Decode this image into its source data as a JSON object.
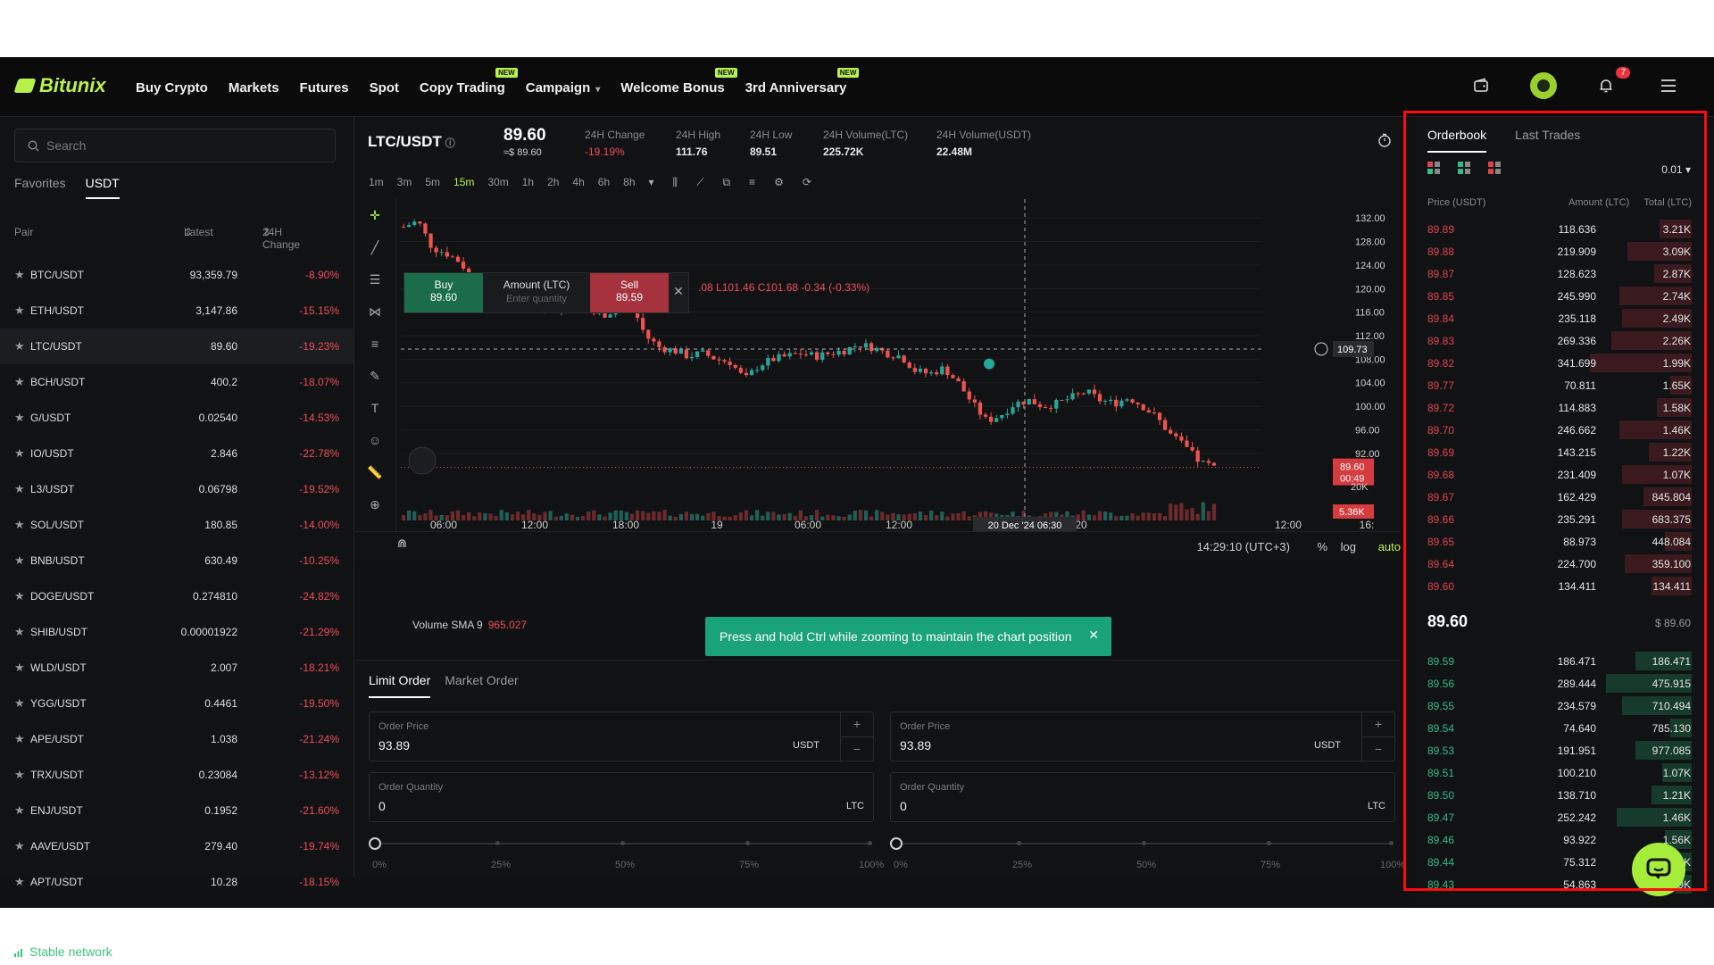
{
  "nav": {
    "brand": "Bitunix",
    "items": [
      {
        "label": "Buy Crypto",
        "new": ""
      },
      {
        "label": "Markets",
        "new": ""
      },
      {
        "label": "Futures",
        "new": ""
      },
      {
        "label": "Spot",
        "new": ""
      },
      {
        "label": "Copy Trading",
        "new": "NEW"
      },
      {
        "label": "Campaign",
        "new": "",
        "caret": "▾"
      },
      {
        "label": "Welcome Bonus",
        "new": "NEW"
      },
      {
        "label": "3rd Anniversary",
        "new": "NEW"
      }
    ],
    "notif_count": "7"
  },
  "left": {
    "search_placeholder": "Search",
    "tabs": [
      "Favorites",
      "USDT"
    ],
    "head": {
      "pair": "Pair",
      "latest": "Latest",
      "change": "24H Change"
    },
    "pairs": [
      {
        "pair": "BTC/USDT",
        "latest": "93,359.79",
        "change": "-8.90%"
      },
      {
        "pair": "ETH/USDT",
        "latest": "3,147.86",
        "change": "-15.15%"
      },
      {
        "pair": "LTC/USDT",
        "latest": "89.60",
        "change": "-19.23%"
      },
      {
        "pair": "BCH/USDT",
        "latest": "400.2",
        "change": "-18.07%"
      },
      {
        "pair": "G/USDT",
        "latest": "0.02540",
        "change": "-14.53%"
      },
      {
        "pair": "IO/USDT",
        "latest": "2.846",
        "change": "-22.78%"
      },
      {
        "pair": "L3/USDT",
        "latest": "0.06798",
        "change": "-19.52%"
      },
      {
        "pair": "SOL/USDT",
        "latest": "180.85",
        "change": "-14.00%"
      },
      {
        "pair": "BNB/USDT",
        "latest": "630.49",
        "change": "-10.25%"
      },
      {
        "pair": "DOGE/USDT",
        "latest": "0.274810",
        "change": "-24.82%"
      },
      {
        "pair": "SHIB/USDT",
        "latest": "0.00001922",
        "change": "-21.29%"
      },
      {
        "pair": "WLD/USDT",
        "latest": "2.007",
        "change": "-18.21%"
      },
      {
        "pair": "YGG/USDT",
        "latest": "0.4461",
        "change": "-19.50%"
      },
      {
        "pair": "APE/USDT",
        "latest": "1.038",
        "change": "-21.24%"
      },
      {
        "pair": "TRX/USDT",
        "latest": "0.23084",
        "change": "-13.12%"
      },
      {
        "pair": "ENJ/USDT",
        "latest": "0.1952",
        "change": "-21.60%"
      },
      {
        "pair": "AAVE/USDT",
        "latest": "279.40",
        "change": "-19.74%"
      },
      {
        "pair": "APT/USDT",
        "latest": "10.28",
        "change": "-18.15%"
      }
    ],
    "status": "Stable network"
  },
  "ticker": {
    "symbol": "LTC/USDT",
    "price": "89.60",
    "price_usd": "≈$ 89.60",
    "stats": [
      {
        "label": "24H Change",
        "value": "-19.19%"
      },
      {
        "label": "24H High",
        "value": "111.76"
      },
      {
        "label": "24H Low",
        "value": "89.51"
      },
      {
        "label": "24H Volume(LTC)",
        "value": "225.72K"
      },
      {
        "label": "24H Volume(USDT)",
        "value": "22.48M"
      }
    ]
  },
  "toolbar": {
    "intervals": [
      "1m",
      "3m",
      "5m",
      "15m",
      "30m",
      "1h",
      "2h",
      "4h",
      "6h",
      "8h"
    ],
    "active": "15m"
  },
  "chart": {
    "quick_order": {
      "buy_label": "Buy",
      "buy_price": "89.60",
      "amount_label": "Amount (LTC)",
      "amount_placeholder": "Enter quantity",
      "sell_label": "Sell",
      "sell_price": "89.59"
    },
    "ohlc_text": ".08  L101.46  C101.68  -0.34 (-0.33%)",
    "volume_label": "Volume SMA 9",
    "volume_value": "965.027",
    "toast": "Press and hold Ctrl while zooming to maintain the chart position",
    "crosshair_price": "109.73",
    "last_price": "89.60",
    "last_timer": "00:49",
    "vol_tag": "5.36K",
    "vol_axis": "20K",
    "crosshair_time": "20 Dec '24   06:30",
    "clock": "14:29:10 (UTC+3)",
    "scale_opts": [
      "%",
      "log",
      "auto"
    ]
  },
  "chart_data": {
    "type": "line",
    "title": "",
    "xlabel": "",
    "ylabel": "",
    "x": [
      "06:00",
      "12:00",
      "18:00",
      "19",
      "06:00",
      "12:00",
      "18:00",
      "20",
      "20 Dec '24 06:30",
      "12:00",
      "16:"
    ],
    "y_ticks": [
      132.0,
      128.0,
      124.0,
      120.0,
      116.0,
      112.0,
      108.0,
      104.0,
      100.0,
      96.0,
      92.0
    ],
    "ylim": [
      90,
      134
    ],
    "series": [
      {
        "values": [
          130.5,
          131.5,
          127.0,
          126.0,
          124.5,
          121.0,
          119.5,
          120.0,
          119.0,
          117.5,
          117.0,
          116.5,
          116.8,
          116.0,
          115.5,
          116.5,
          117.5,
          112.0,
          110.0,
          109.5,
          108.5,
          109.0,
          108.0,
          107.5,
          104.5,
          107.0,
          108.0,
          108.5,
          109.0,
          108.5,
          109.0,
          109.5,
          110.5,
          110.0,
          109.0,
          108.5,
          106.0,
          105.5,
          106.5,
          104.0,
          100.5,
          97.5,
          98.5,
          100.5,
          101.0,
          100.0,
          100.5,
          101.5,
          102.5,
          101.0,
          100.5,
          101.5,
          100.0,
          98.0,
          95.0,
          93.0,
          90.5,
          89.6
        ]
      }
    ],
    "grid": true
  },
  "form": {
    "tabs": [
      "Limit Order",
      "Market Order"
    ],
    "buy": {
      "price_label": "Order Price",
      "price": "93.89",
      "price_unit": "USDT",
      "qty_label": "Order Quantity",
      "qty": "0",
      "qty_unit": "LTC"
    },
    "sell": {
      "price_label": "Order Price",
      "price": "93.89",
      "price_unit": "USDT",
      "qty_label": "Order Quantity",
      "qty": "0",
      "qty_unit": "LTC"
    },
    "ticks": [
      "0%",
      "25%",
      "50%",
      "75%",
      "100%"
    ]
  },
  "orderbook": {
    "tabs": [
      "Orderbook",
      "Last Trades"
    ],
    "precision": "0.01",
    "head": {
      "price": "Price (USDT)",
      "amount": "Amount (LTC)",
      "total": "Total (LTC)"
    },
    "asks": [
      {
        "price": "89.89",
        "amount": "118.636",
        "total": "3.21K",
        "depth": 0.12
      },
      {
        "price": "89.88",
        "amount": "219.909",
        "total": "3.09K",
        "depth": 0.24
      },
      {
        "price": "89.87",
        "amount": "128.623",
        "total": "2.87K",
        "depth": 0.14
      },
      {
        "price": "89.85",
        "amount": "245.990",
        "total": "2.74K",
        "depth": 0.27
      },
      {
        "price": "89.84",
        "amount": "235.118",
        "total": "2.49K",
        "depth": 0.26
      },
      {
        "price": "89.83",
        "amount": "269.336",
        "total": "2.26K",
        "depth": 0.3
      },
      {
        "price": "89.82",
        "amount": "341.699",
        "total": "1.99K",
        "depth": 0.38
      },
      {
        "price": "89.77",
        "amount": "70.811",
        "total": "1.65K",
        "depth": 0.08
      },
      {
        "price": "89.72",
        "amount": "114.883",
        "total": "1.58K",
        "depth": 0.13
      },
      {
        "price": "89.70",
        "amount": "246.662",
        "total": "1.46K",
        "depth": 0.27
      },
      {
        "price": "89.69",
        "amount": "143.215",
        "total": "1.22K",
        "depth": 0.16
      },
      {
        "price": "89.68",
        "amount": "231.409",
        "total": "1.07K",
        "depth": 0.26
      },
      {
        "price": "89.67",
        "amount": "162.429",
        "total": "845.804",
        "depth": 0.18
      },
      {
        "price": "89.66",
        "amount": "235.291",
        "total": "683.375",
        "depth": 0.26
      },
      {
        "price": "89.65",
        "amount": "88.973",
        "total": "448.084",
        "depth": 0.1
      },
      {
        "price": "89.64",
        "amount": "224.700",
        "total": "359.100",
        "depth": 0.25
      },
      {
        "price": "89.60",
        "amount": "134.411",
        "total": "134.411",
        "depth": 0.15
      }
    ],
    "mid_price": "89.60",
    "mid_usd": "$ 89.60",
    "bids": [
      {
        "price": "89.59",
        "amount": "186.471",
        "total": "186.471",
        "depth": 0.21
      },
      {
        "price": "89.56",
        "amount": "289.444",
        "total": "475.915",
        "depth": 0.32
      },
      {
        "price": "89.55",
        "amount": "234.579",
        "total": "710.494",
        "depth": 0.26
      },
      {
        "price": "89.54",
        "amount": "74.640",
        "total": "785.130",
        "depth": 0.08
      },
      {
        "price": "89.53",
        "amount": "191.951",
        "total": "977.085",
        "depth": 0.21
      },
      {
        "price": "89.51",
        "amount": "100.210",
        "total": "1.07K",
        "depth": 0.11
      },
      {
        "price": "89.50",
        "amount": "138.710",
        "total": "1.21K",
        "depth": 0.15
      },
      {
        "price": "89.47",
        "amount": "252.242",
        "total": "1.46K",
        "depth": 0.28
      },
      {
        "price": "89.46",
        "amount": "93.922",
        "total": "1.56K",
        "depth": 0.1
      },
      {
        "price": "89.44",
        "amount": "75.312",
        "total": "1.63K",
        "depth": 0.08
      },
      {
        "price": "89.43",
        "amount": "54.863",
        "total": "1.69K",
        "depth": 0.06
      }
    ]
  },
  "colors": {
    "accent": "#b9f14b",
    "up": "#26a69a",
    "down": "#ef5350",
    "ask": "#e0424f",
    "bid": "#2ebd85",
    "highlight": "#ff0a0a"
  }
}
